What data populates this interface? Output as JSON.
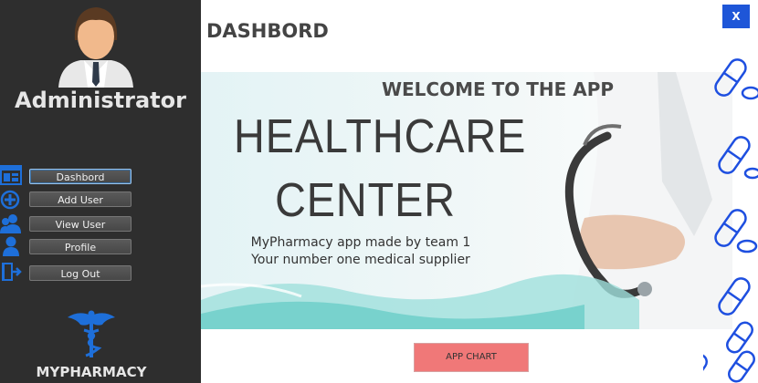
{
  "sidebar": {
    "user_title": "Administrator",
    "nav": [
      {
        "label": "Dashbord",
        "icon": "dashboard-icon",
        "active": true
      },
      {
        "label": "Add User",
        "icon": "add-circle-icon"
      },
      {
        "label": "View User",
        "icon": "users-icon"
      },
      {
        "label": "Profile",
        "icon": "person-icon"
      },
      {
        "label": "Log Out",
        "icon": "logout-door-icon"
      }
    ],
    "brand": "MYPHARMACY",
    "brand_icon": "caduceus-icon",
    "avatar_icon": "admin-avatar-icon"
  },
  "header": {
    "title": "DASHBORD",
    "close_label": "X"
  },
  "banner": {
    "welcome": "WELCOME TO THE APP",
    "headline_line1": "HEALTHCARE",
    "headline_line2": "CENTER",
    "tagline_line1": "MyPharmacy app made by team 1",
    "tagline_line2": "Your number one medical supplier",
    "image": "doctor-stethoscope-image"
  },
  "actions": {
    "app_chart_label": "APP CHART"
  },
  "decor": {
    "pills_icon": "pill-capsule-icon"
  },
  "colors": {
    "sidebar_bg": "#2e2e2e",
    "close_button": "#1e56d8",
    "app_chart_button": "#f07878",
    "nav_icon": "#1e6fd9",
    "teal_wave": "#7fd6d0"
  }
}
